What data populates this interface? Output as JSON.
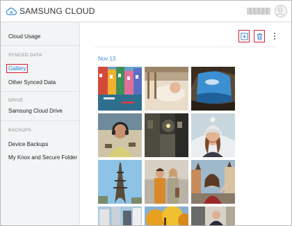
{
  "header": {
    "title": "SAMSUNG CLOUD",
    "logo_icon": "cloud-icon",
    "account_icon": "account-avatar-icon"
  },
  "sidebar": {
    "cloud_usage": "Cloud Usage",
    "synced_data_heading": "SYNCED DATA",
    "gallery": "Gallery",
    "other_synced_data": "Other Synced Data",
    "drive_heading": "DRIVE",
    "samsung_cloud_drive": "Samsung Cloud Drive",
    "backups_heading": "BACKUPS",
    "device_backups": "Device Backups",
    "knox": "My Knox and Secure Folder"
  },
  "toolbar": {
    "download_icon": "download-icon",
    "delete_icon": "trash-icon",
    "more_icon": "more-vertical-icon"
  },
  "gallery": {
    "date": "Nov 13",
    "photos": [
      {
        "subject": "colorful canal houses"
      },
      {
        "subject": "sleeping baby"
      },
      {
        "subject": "sea cave and cliff"
      },
      {
        "subject": "man with headphones"
      },
      {
        "subject": "dark alley street light"
      },
      {
        "subject": "smiling woman in winter hat"
      },
      {
        "subject": "eiffel tower"
      },
      {
        "subject": "couple in city"
      },
      {
        "subject": "woman selfie in old town square"
      },
      {
        "subject": "city buildings"
      },
      {
        "subject": "autumn trees"
      },
      {
        "subject": "person in street"
      }
    ]
  },
  "colors": {
    "accent": "#1c85d6",
    "highlight_box": "#d91c2c",
    "sidebar_bg": "#f3f4f5"
  }
}
